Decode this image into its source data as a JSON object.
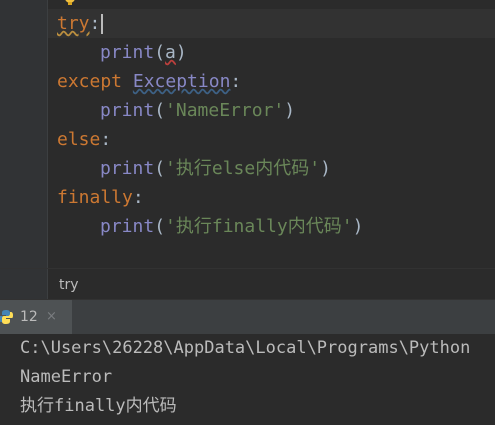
{
  "editor": {
    "lines": [
      {
        "kw": "try",
        "punct": ":"
      },
      {
        "fn": "print",
        "open": "(",
        "arg": "a",
        "close": ")"
      },
      {
        "kw": "except",
        "cls": "Exception",
        "punct": ":"
      },
      {
        "fn": "print",
        "open": "(",
        "str": "'NameError'",
        "close": ")"
      },
      {
        "kw": "else",
        "punct": ":"
      },
      {
        "fn": "print",
        "open": "(",
        "str": "'执行else内代码'",
        "close": ")"
      },
      {
        "kw": "finally",
        "punct": ":"
      },
      {
        "fn": "print",
        "open": "(",
        "str": "'执行finally内代码'",
        "close": ")"
      }
    ]
  },
  "breadcrumb": {
    "text": "try"
  },
  "run": {
    "tab_label": "12",
    "close_glyph": "×",
    "output": [
      "C:\\Users\\26228\\AppData\\Local\\Programs\\Python",
      "NameError",
      "执行finally内代码"
    ]
  },
  "icons": {
    "bulb": "lightbulb-icon",
    "python": "python-icon",
    "close": "close-icon"
  },
  "colors": {
    "keyword": "#cc7832",
    "builtin": "#8888c6",
    "string": "#6a8759",
    "text": "#a9b7c6"
  }
}
